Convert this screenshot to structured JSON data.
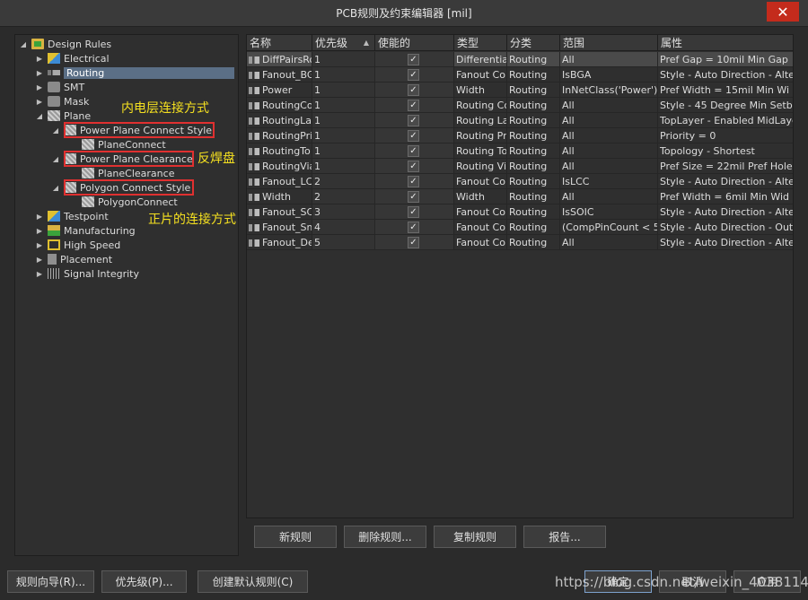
{
  "window": {
    "title": "PCB规则及约束编辑器 [mil]",
    "close_glyph": "✕"
  },
  "tree": {
    "root": "Design Rules",
    "items": [
      {
        "label": "Electrical"
      },
      {
        "label": "Routing"
      },
      {
        "label": "SMT"
      },
      {
        "label": "Mask"
      },
      {
        "label": "Plane"
      },
      {
        "label": "Power Plane Connect Style"
      },
      {
        "label": "PlaneConnect"
      },
      {
        "label": "Power Plane Clearance"
      },
      {
        "label": "PlaneClearance"
      },
      {
        "label": "Polygon Connect Style"
      },
      {
        "label": "PolygonConnect"
      },
      {
        "label": "Testpoint"
      },
      {
        "label": "Manufacturing"
      },
      {
        "label": "High Speed"
      },
      {
        "label": "Placement"
      },
      {
        "label": "Signal Integrity"
      }
    ]
  },
  "annotations": {
    "inner_layer": "内电层连接方式",
    "anti_pad": "反焊盘",
    "positive_plane": "正片的连接方式"
  },
  "grid": {
    "columns": [
      "名称",
      "优先级",
      "使能的",
      "类型",
      "分类",
      "范围",
      "属性"
    ],
    "rows": [
      [
        "DiffPairsRo",
        "1",
        "✓",
        "Differentia",
        "Routing",
        "All",
        "Pref Gap = 10mil   Min Gap"
      ],
      [
        "Fanout_BG",
        "1",
        "✓",
        "Fanout Co",
        "Routing",
        "IsBGA",
        "Style - Auto   Direction - Alte"
      ],
      [
        "Power",
        "1",
        "✓",
        "Width",
        "Routing",
        "InNetClass('Power')",
        "Pref Width = 15mil   Min Wi"
      ],
      [
        "RoutingCo",
        "1",
        "✓",
        "Routing Co",
        "Routing",
        "All",
        "Style - 45 Degree   Min Setba"
      ],
      [
        "RoutingLay",
        "1",
        "✓",
        "Routing La",
        "Routing",
        "All",
        "TopLayer - Enabled MidLayer"
      ],
      [
        "RoutingPri",
        "1",
        "✓",
        "Routing Pr",
        "Routing",
        "All",
        "Priority = 0"
      ],
      [
        "RoutingTo",
        "1",
        "✓",
        "Routing To",
        "Routing",
        "All",
        "Topology - Shortest"
      ],
      [
        "RoutingVia",
        "1",
        "✓",
        "Routing Vi",
        "Routing",
        "All",
        "Pref Size = 22mil   Pref Hole"
      ],
      [
        "Fanout_LC",
        "2",
        "✓",
        "Fanout Co",
        "Routing",
        "IsLCC",
        "Style - Auto   Direction - Alte"
      ],
      [
        "Width",
        "2",
        "✓",
        "Width",
        "Routing",
        "All",
        "Pref Width = 6mil   Min Wid"
      ],
      [
        "Fanout_SC",
        "3",
        "✓",
        "Fanout Co",
        "Routing",
        "IsSOIC",
        "Style - Auto   Direction - Alte"
      ],
      [
        "Fanout_Sm",
        "4",
        "✓",
        "Fanout Co",
        "Routing",
        "(CompPinCount < 5)",
        "Style - Auto   Direction - Out"
      ],
      [
        "Fanout_De",
        "5",
        "✓",
        "Fanout Co",
        "Routing",
        "All",
        "Style - Auto   Direction - Alte"
      ]
    ]
  },
  "buttons": {
    "new_rule": "新规则",
    "delete_rule": "删除规则...",
    "copy_rule": "复制规则",
    "report": "报告...",
    "rule_wizard": "规则向导(R)...",
    "priority": "优先级(P)...",
    "create_default": "创建默认规则(C)",
    "ok": "确定",
    "cancel": "取消",
    "apply": "应用"
  },
  "watermark": "https://blog.csdn.net/weixin_40381143"
}
